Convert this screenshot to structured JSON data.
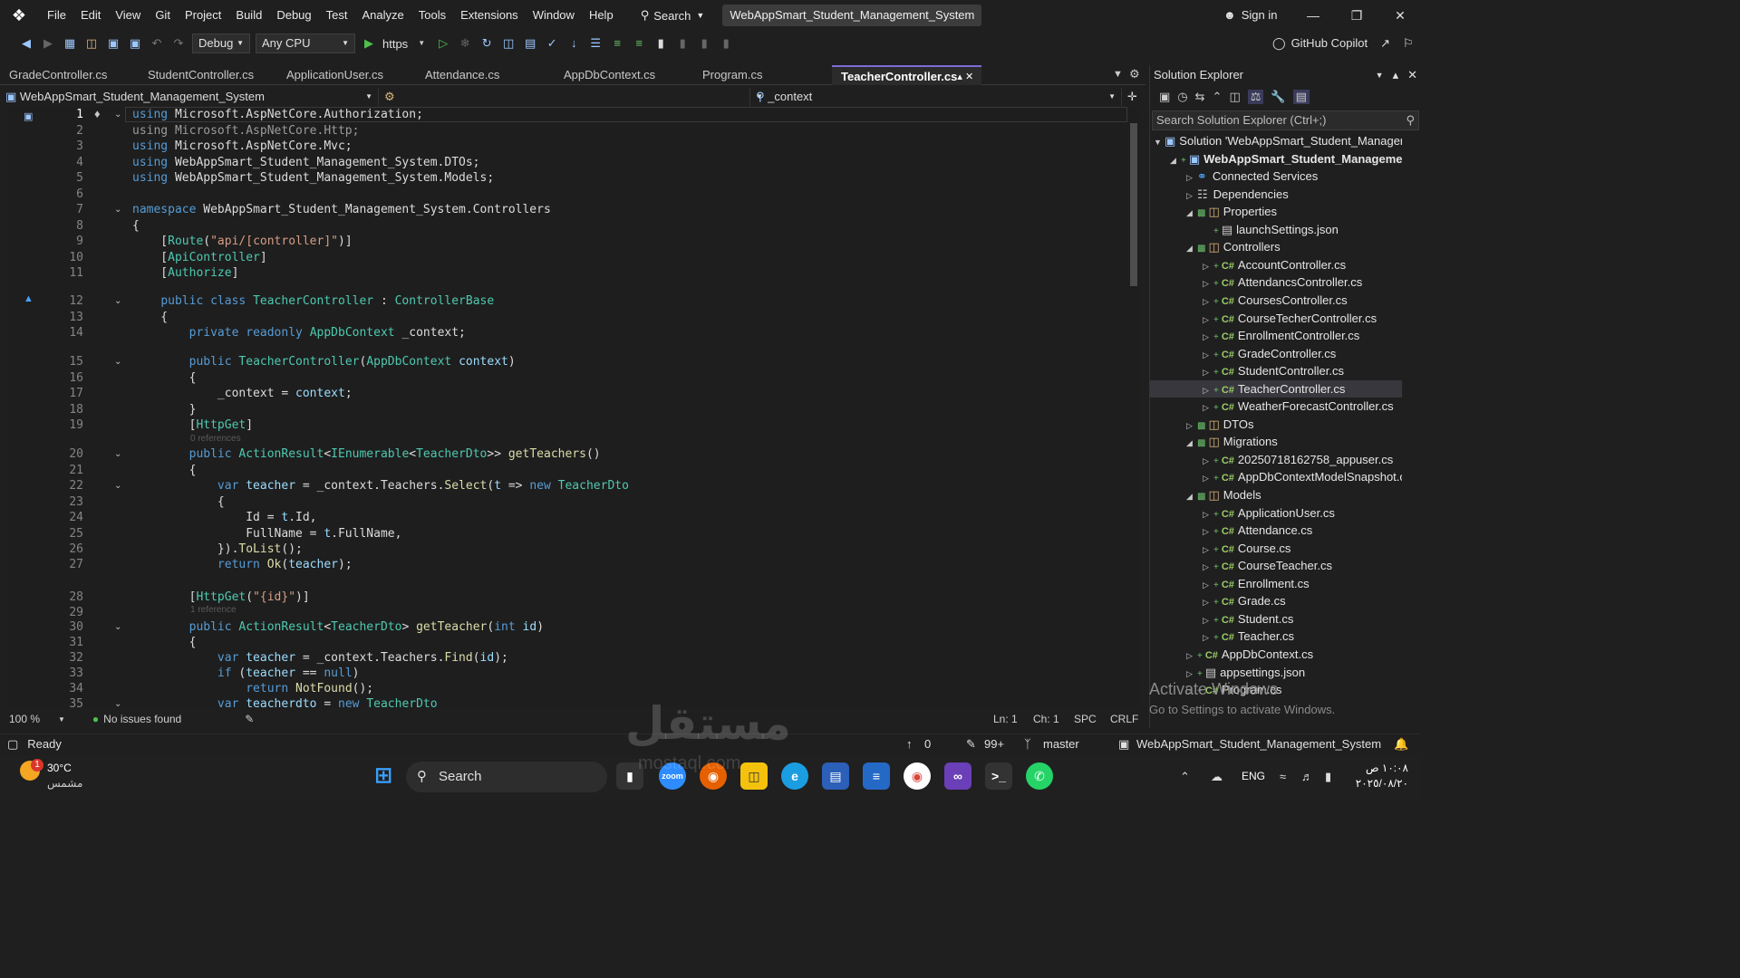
{
  "titlebar": {
    "menus": [
      "File",
      "Edit",
      "View",
      "Git",
      "Project",
      "Build",
      "Debug",
      "Test",
      "Analyze",
      "Tools",
      "Extensions",
      "Window",
      "Help"
    ],
    "search_label": "Search",
    "solution_title": "WebAppSmart_Student_Management_System",
    "sign_in": "Sign in"
  },
  "toolbar": {
    "config": "Debug",
    "platform": "Any CPU",
    "run_target": "https",
    "copilot": "GitHub Copilot"
  },
  "tabs": [
    {
      "label": "GradeController.cs",
      "active": false
    },
    {
      "label": "StudentController.cs",
      "active": false
    },
    {
      "label": "ApplicationUser.cs",
      "active": false
    },
    {
      "label": "Attendance.cs",
      "active": false
    },
    {
      "label": "AppDbContext.cs",
      "active": false
    },
    {
      "label": "Program.cs",
      "active": false
    },
    {
      "label": "TeacherController.cs",
      "active": true
    }
  ],
  "navbar": {
    "project": "WebAppSmart_Student_Management_System",
    "type": "WebAppSmart_Student_Management_System.Controllers.TeacherCon",
    "member": "_context"
  },
  "editor": {
    "line_numbers": [
      "1",
      "2",
      "3",
      "4",
      "5",
      "6",
      "7",
      "8",
      "9",
      "10",
      "11",
      "12",
      "13",
      "14",
      "15",
      "16",
      "17",
      "18",
      "19",
      "20",
      "21",
      "22",
      "23",
      "24",
      "25",
      "26",
      "27",
      "28",
      "29",
      "30",
      "31",
      "32",
      "33",
      "34",
      "35"
    ],
    "hints": {
      "h20": "0 references",
      "h30": "1 reference"
    }
  },
  "editor_status": {
    "zoom": "100 %",
    "issues": "No issues found",
    "line": "Ln: 1",
    "col": "Ch: 1",
    "spacing": "SPC",
    "eol": "CRLF"
  },
  "solution_explorer": {
    "title": "Solution Explorer",
    "search_placeholder": "Search Solution Explorer (Ctrl+;)",
    "items": [
      {
        "label": "Solution 'WebAppSmart_Student_Manageme",
        "depth": 0,
        "icon": "solution"
      },
      {
        "label": "WebAppSmart_Student_Management_S",
        "depth": 1,
        "icon": "project",
        "bold": true
      },
      {
        "label": "Connected Services",
        "depth": 2,
        "icon": "connected"
      },
      {
        "label": "Dependencies",
        "depth": 2,
        "icon": "deps"
      },
      {
        "label": "Properties",
        "depth": 2,
        "icon": "folder"
      },
      {
        "label": "launchSettings.json",
        "depth": 3,
        "icon": "json"
      },
      {
        "label": "Controllers",
        "depth": 2,
        "icon": "folder"
      },
      {
        "label": "AccountController.cs",
        "depth": 3,
        "icon": "cs"
      },
      {
        "label": "AttendancsController.cs",
        "depth": 3,
        "icon": "cs"
      },
      {
        "label": "CoursesController.cs",
        "depth": 3,
        "icon": "cs"
      },
      {
        "label": "CourseTecherController.cs",
        "depth": 3,
        "icon": "cs"
      },
      {
        "label": "EnrollmentController.cs",
        "depth": 3,
        "icon": "cs"
      },
      {
        "label": "GradeController.cs",
        "depth": 3,
        "icon": "cs"
      },
      {
        "label": "StudentController.cs",
        "depth": 3,
        "icon": "cs"
      },
      {
        "label": "TeacherController.cs",
        "depth": 3,
        "icon": "cs",
        "selected": true
      },
      {
        "label": "WeatherForecastController.cs",
        "depth": 3,
        "icon": "cs"
      },
      {
        "label": "DTOs",
        "depth": 2,
        "icon": "folder"
      },
      {
        "label": "Migrations",
        "depth": 2,
        "icon": "folder"
      },
      {
        "label": "20250718162758_appuser.cs",
        "depth": 3,
        "icon": "cs"
      },
      {
        "label": "AppDbContextModelSnapshot.cs",
        "depth": 3,
        "icon": "cs"
      },
      {
        "label": "Models",
        "depth": 2,
        "icon": "folder"
      },
      {
        "label": "ApplicationUser.cs",
        "depth": 3,
        "icon": "cs"
      },
      {
        "label": "Attendance.cs",
        "depth": 3,
        "icon": "cs"
      },
      {
        "label": "Course.cs",
        "depth": 3,
        "icon": "cs"
      },
      {
        "label": "CourseTeacher.cs",
        "depth": 3,
        "icon": "cs"
      },
      {
        "label": "Enrollment.cs",
        "depth": 3,
        "icon": "cs"
      },
      {
        "label": "Grade.cs",
        "depth": 3,
        "icon": "cs"
      },
      {
        "label": "Student.cs",
        "depth": 3,
        "icon": "cs"
      },
      {
        "label": "Teacher.cs",
        "depth": 3,
        "icon": "cs"
      },
      {
        "label": "AppDbContext.cs",
        "depth": 2,
        "icon": "cs"
      },
      {
        "label": "appsettings.json",
        "depth": 2,
        "icon": "json"
      },
      {
        "label": "Program.cs",
        "depth": 2,
        "icon": "cs"
      }
    ],
    "watermark_line1": "Activate Windows",
    "watermark_line2": "Go to Settings to activate Windows."
  },
  "statusbar": {
    "ready": "Ready",
    "errors": "0",
    "changes": "99+",
    "branch": "master",
    "repo": "WebAppSmart_Student_Management_System"
  },
  "taskbar": {
    "weather_temp": "30°C",
    "weather_text": "مشمس",
    "search": "Search",
    "lang": "ENG",
    "time": "١٠:٠٨ ص",
    "date": "٢٠٢٥/٠٨/٢٠",
    "notif_count": "1"
  },
  "overlay": {
    "watermark": "مستقل",
    "watermark_sub": "mostaql.com"
  }
}
